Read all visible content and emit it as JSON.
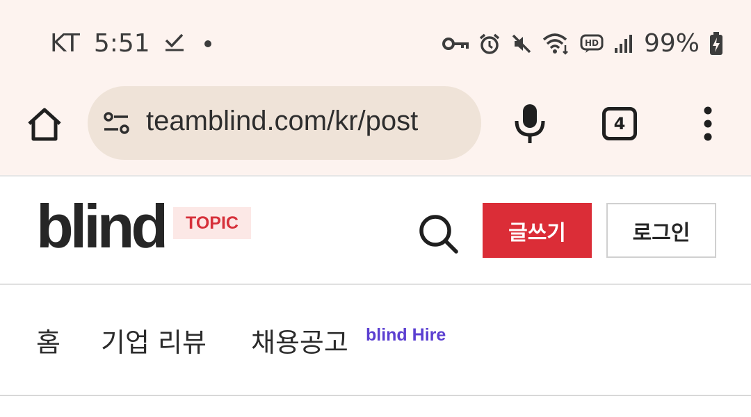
{
  "status_bar": {
    "carrier": "KT",
    "time": "5:51",
    "battery": "99%"
  },
  "browser": {
    "url": "teamblind.com/kr/post",
    "tab_count": "4"
  },
  "header": {
    "logo": "blind",
    "topic_badge": "TOPIC",
    "write_label": "글쓰기",
    "login_label": "로그인",
    "accent_color": "#db2d37"
  },
  "nav": {
    "home": "홈",
    "reviews": "기업 리뷰",
    "jobs": "채용공고",
    "hire_badge": "blind Hire",
    "hire_color": "#5b3fd1"
  }
}
